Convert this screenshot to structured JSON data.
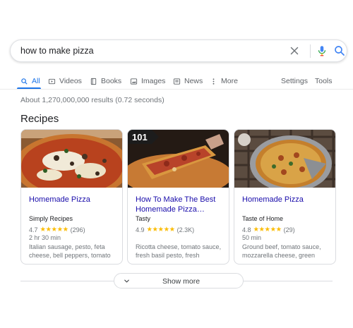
{
  "search": {
    "query": "how to make pizza"
  },
  "tabs": [
    {
      "label": "All",
      "icon": "search-icon",
      "active": true
    },
    {
      "label": "Videos",
      "icon": "video-icon"
    },
    {
      "label": "Books",
      "icon": "book-icon"
    },
    {
      "label": "Images",
      "icon": "image-icon"
    },
    {
      "label": "News",
      "icon": "news-icon"
    },
    {
      "label": "More",
      "icon": "more-vert-icon"
    }
  ],
  "settings_label": "Settings",
  "tools_label": "Tools",
  "result_stats": "About 1,270,000,000 results (0.72 seconds)",
  "section_title": "Recipes",
  "recipes": [
    {
      "title": "Homemade Pizza",
      "source": "Simply Recipes",
      "rating": "4.7",
      "stars": "★★★★★",
      "reviews": "(296)",
      "time": "2 hr 30 min",
      "ingredients": "Italian sausage, pesto, feta cheese, bell peppers, tomato"
    },
    {
      "title": "How To Make The Best Homemade Pizza…",
      "source": "Tasty",
      "rating": "4.9",
      "stars": "★★★★★",
      "reviews": "(2.3K)",
      "time": "",
      "ingredients": "Ricotta cheese, tomato sauce, fresh basil pesto, fresh",
      "thumb_badge": "101"
    },
    {
      "title": "Homemade Pizza",
      "source": "Taste of Home",
      "rating": "4.8",
      "stars": "★★★★★",
      "reviews": "(29)",
      "time": "50 min",
      "ingredients": "Ground beef, tomato sauce, mozzarella cheese, green"
    }
  ],
  "show_more_label": "Show more",
  "colors": {
    "accent": "#1a73e8",
    "link": "#1a0dab",
    "star": "#fbbc04",
    "muted": "#70757a"
  }
}
